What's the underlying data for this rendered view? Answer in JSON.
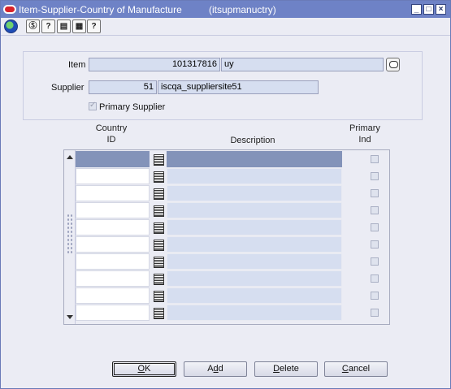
{
  "window": {
    "title": "Item-Supplier-Country of Manufacture",
    "code": "(itsupmanuctry)",
    "minimize_glyph": "_",
    "maximize_glyph": "□",
    "close_glyph": "×"
  },
  "toolbar": {
    "icons": [
      "globe-icon",
      "help-about-icon",
      "find-icon",
      "document-icon",
      "print-icon",
      "help-icon"
    ],
    "icon_glyphs": [
      "",
      "Ⓢ",
      "?",
      "▤",
      "▦",
      "?"
    ]
  },
  "header": {
    "item_label": "Item",
    "item_id": "101317816",
    "item_desc": "uy",
    "supplier_label": "Supplier",
    "supplier_id": "51",
    "supplier_desc": "iscqa_suppliersite51",
    "primary_supplier_label": "Primary Supplier",
    "primary_supplier_checked": true
  },
  "table": {
    "columns": {
      "country_id_line1": "Country",
      "country_id_line2": "ID",
      "description": "Description",
      "primary_ind_line1": "Primary",
      "primary_ind_line2": "Ind"
    },
    "rows": [
      {
        "country_id": "",
        "description": "",
        "primary_ind": false,
        "selected": true
      },
      {
        "country_id": "",
        "description": "",
        "primary_ind": false
      },
      {
        "country_id": "",
        "description": "",
        "primary_ind": false
      },
      {
        "country_id": "",
        "description": "",
        "primary_ind": false
      },
      {
        "country_id": "",
        "description": "",
        "primary_ind": false
      },
      {
        "country_id": "",
        "description": "",
        "primary_ind": false
      },
      {
        "country_id": "",
        "description": "",
        "primary_ind": false
      },
      {
        "country_id": "",
        "description": "",
        "primary_ind": false
      },
      {
        "country_id": "",
        "description": "",
        "primary_ind": false
      },
      {
        "country_id": "",
        "description": "",
        "primary_ind": false
      }
    ]
  },
  "buttons": {
    "ok_pre": "",
    "ok_key": "O",
    "ok_post": "K",
    "add_pre": "A",
    "add_key": "d",
    "add_post": "d",
    "delete_pre": "",
    "delete_key": "D",
    "delete_post": "elete",
    "cancel_pre": "",
    "cancel_key": "C",
    "cancel_post": "ancel"
  },
  "colors": {
    "titlebar": "#6e82c6",
    "background": "#ebecf4",
    "field": "#d6def0",
    "selected_row": "#8393b9"
  }
}
